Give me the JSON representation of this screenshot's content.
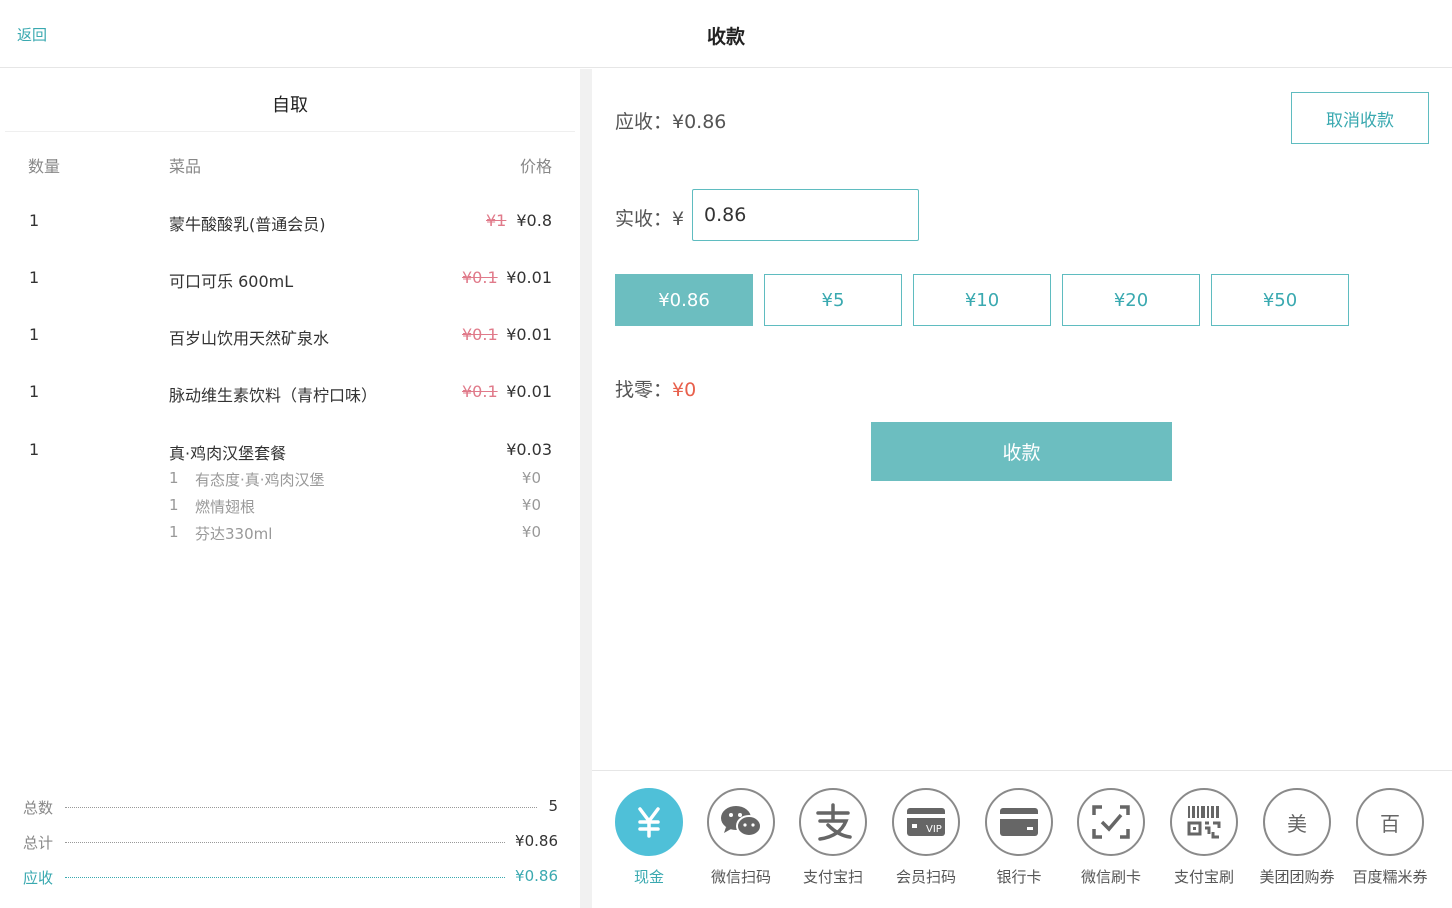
{
  "header": {
    "back_label": "返回",
    "title": "收款"
  },
  "order": {
    "title": "自取",
    "columns": {
      "qty": "数量",
      "item": "菜品",
      "price": "价格"
    },
    "items": [
      {
        "qty": "1",
        "name": "蒙牛酸酸乳(普通会员)",
        "original_price": "¥1",
        "price": "¥0.8"
      },
      {
        "qty": "1",
        "name": "可口可乐 600mL",
        "original_price": "¥0.1",
        "price": "¥0.01"
      },
      {
        "qty": "1",
        "name": "百岁山饮用天然矿泉水",
        "original_price": "¥0.1",
        "price": "¥0.01"
      },
      {
        "qty": "1",
        "name": "脉动维生素饮料（青柠口味）",
        "original_price": "¥0.1",
        "price": "¥0.01"
      },
      {
        "qty": "1",
        "name": "真·鸡肉汉堡套餐",
        "original_price": "",
        "price": "¥0.03",
        "sub_items": [
          {
            "qty": "1",
            "name": "有态度·真·鸡肉汉堡",
            "price": "¥0"
          },
          {
            "qty": "1",
            "name": "燃情翅根",
            "price": "¥0"
          },
          {
            "qty": "1",
            "name": "芬达330ml",
            "price": "¥0"
          }
        ]
      }
    ],
    "summary": [
      {
        "label": "总数",
        "value": "5"
      },
      {
        "label": "总计",
        "value": "¥0.86"
      },
      {
        "label": "应收",
        "value": "¥0.86"
      }
    ]
  },
  "payment": {
    "due_label": "应收：¥0.86",
    "cancel_label": "取消收款",
    "paid_label": "实收：¥",
    "paid_value": "0.86",
    "quick_amounts": [
      "¥0.86",
      "¥5",
      "¥10",
      "¥20",
      "¥50"
    ],
    "selected_quick_index": 0,
    "change_label": "找零：",
    "change_value": "¥0",
    "submit_label": "收款",
    "accent_color": "#6cbec0",
    "change_color": "#e8604c",
    "methods": [
      {
        "label": "现金",
        "icon": "yuan-icon",
        "active": true
      },
      {
        "label": "微信扫码",
        "icon": "wechat-icon",
        "active": false
      },
      {
        "label": "支付宝扫",
        "icon": "alipay-icon",
        "active": false
      },
      {
        "label": "会员扫码",
        "icon": "vip-card-icon",
        "active": false
      },
      {
        "label": "银行卡",
        "icon": "bank-card-icon",
        "active": false
      },
      {
        "label": "微信刷卡",
        "icon": "scan-check-icon",
        "active": false
      },
      {
        "label": "支付宝刷",
        "icon": "barcode-icon",
        "active": false
      },
      {
        "label": "美团团购券",
        "icon": "meituan-icon",
        "icon_text": "美",
        "active": false
      },
      {
        "label": "百度糯米券",
        "icon": "baidu-nuomi-icon",
        "icon_text": "百",
        "active": false
      }
    ]
  }
}
